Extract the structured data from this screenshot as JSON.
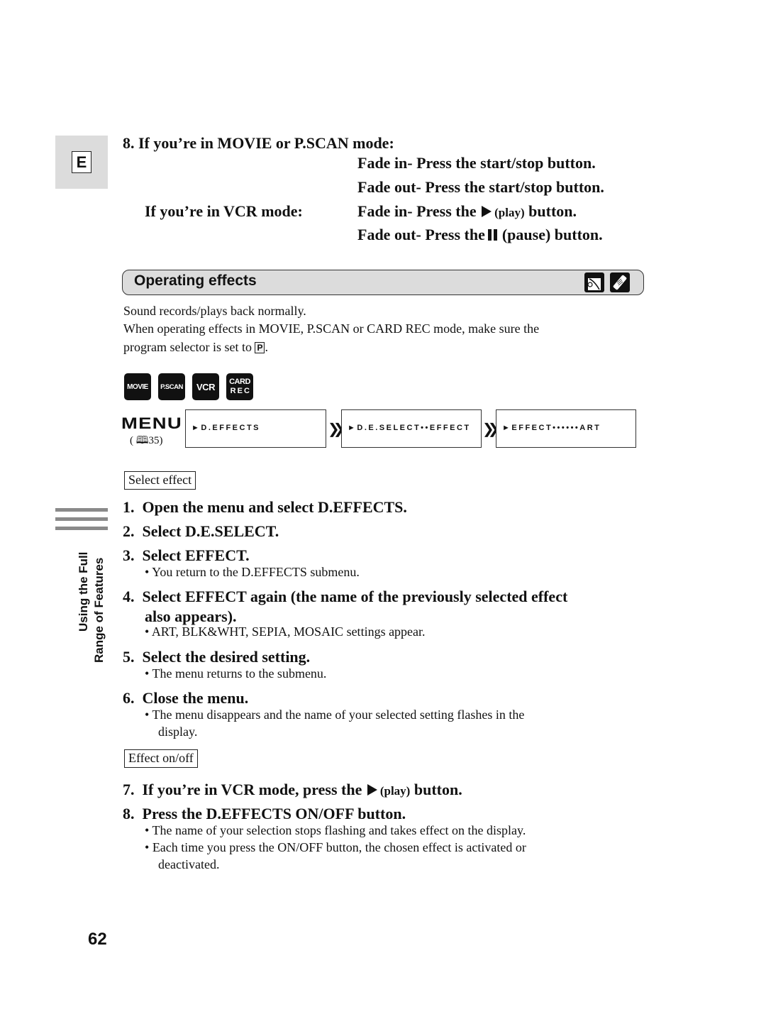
{
  "language_tab": "E",
  "step8_top": {
    "heading": "8.  If you’re in MOVIE or P.SCAN mode:",
    "movie_fade_in": "Fade in- Press the start/stop button.",
    "movie_fade_out": "Fade out- Press the start/stop button.",
    "vcr_label": "If you’re in VCR mode:",
    "vcr_fade_in_pre": "Fade in- Press the",
    "vcr_fade_in_paren": "(play)",
    "vcr_fade_in_post": "button.",
    "vcr_fade_out_pre": "Fade out- Press the",
    "vcr_fade_out_post": "(pause) button."
  },
  "section": {
    "title": "Operating effects",
    "icons": [
      "camcorder-icon",
      "remote-control-icon"
    ]
  },
  "intro": {
    "line1": "Sound records/plays back normally.",
    "line2": "When operating effects in MOVIE, P.SCAN or CARD REC mode, make sure the",
    "line3_pre": "program selector is set to",
    "line3_symbol": "P",
    "line3_post": "."
  },
  "modes": [
    {
      "label": "MOVIE"
    },
    {
      "label": "P.SCAN"
    },
    {
      "label": "VCR"
    },
    {
      "label": "CARD",
      "label2": "R E C"
    }
  ],
  "menu": {
    "label": "MENU",
    "page_ref": "35",
    "screens": [
      "►D.EFFECTS",
      "►D.E.SELECT••EFFECT",
      "►EFFECT••••••ART"
    ]
  },
  "select_effect": {
    "label": "Select effect",
    "steps": [
      {
        "num": "1.",
        "text": "Open the menu and select D.EFFECTS."
      },
      {
        "num": "2.",
        "text": "Select D.E.SELECT."
      },
      {
        "num": "3.",
        "text": "Select EFFECT.",
        "note": "You return to the D.EFFECTS submenu."
      },
      {
        "num": "4.",
        "text": "Select EFFECT again (the name of the previously selected effect",
        "text2": "also appears).",
        "note": "ART, BLK&WHT, SEPIA, MOSAIC settings appear."
      },
      {
        "num": "5.",
        "text": "Select the desired setting.",
        "note": "The menu returns to the submenu."
      },
      {
        "num": "6.",
        "text": "Close the menu.",
        "note": "The menu disappears and the name of your selected setting flashes in the",
        "note2": "display."
      }
    ]
  },
  "effect_onoff": {
    "label": "Effect on/off",
    "step7_pre": "If you’re in VCR mode, press the",
    "step7_paren": "(play)",
    "step7_post": "button.",
    "step7_num": "7.",
    "step8_num": "8.",
    "step8": "Press the D.EFFECTS ON/OFF button.",
    "note1": "The name of your selection stops flashing and takes effect on the display.",
    "note2": "Each time you press the ON/OFF button, the chosen effect is activated or",
    "note2b": "deactivated."
  },
  "side_tab": {
    "line1": "Using the Full",
    "line2": "Range of Features"
  },
  "page_number": "62"
}
